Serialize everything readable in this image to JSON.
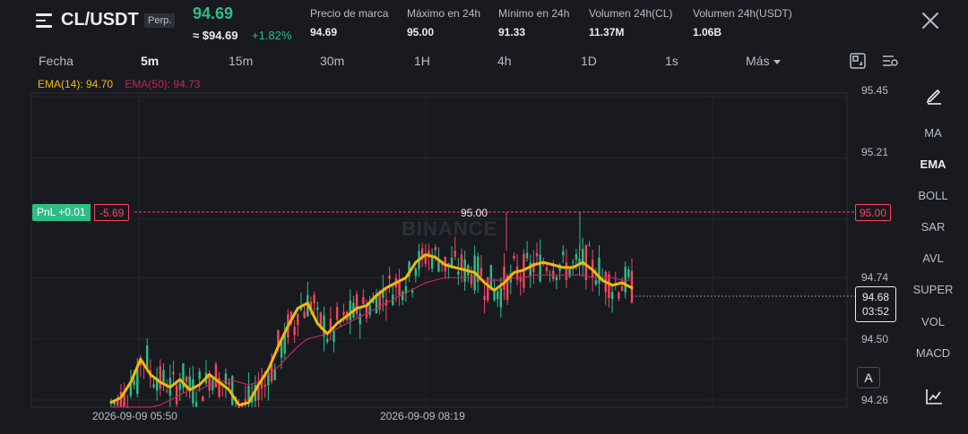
{
  "header": {
    "symbol": "CL/USDT",
    "contract_type": "Perp.",
    "last_price": "94.69",
    "usd_price": "≈ $94.69",
    "change_pct": "+1.82%",
    "stats": [
      {
        "label": "Precio de marca",
        "value": "94.69"
      },
      {
        "label": "Máximo en 24h",
        "value": "95.00"
      },
      {
        "label": "Mínimo en 24h",
        "value": "91.33"
      },
      {
        "label": "Volumen 24h(CL)",
        "value": "11.37M"
      },
      {
        "label": "Volumen 24h(USDT)",
        "value": "1.06B"
      }
    ]
  },
  "timeframes": [
    "Fecha",
    "5m",
    "15m",
    "30m",
    "1H",
    "4h",
    "1D",
    "1s",
    "Más"
  ],
  "active_timeframe": "5m",
  "legend": {
    "ema14": "EMA(14): 94.70",
    "ema50": "EMA(50): 94.73"
  },
  "indicators": [
    "MA",
    "EMA",
    "BOLL",
    "SAR",
    "AVL",
    "SUPER",
    "VOL",
    "MACD"
  ],
  "active_indicator": "EMA",
  "price_axis": [
    "95.45",
    "95.21",
    "94.74",
    "94.50",
    "94.26"
  ],
  "position": {
    "pnl_label": "PnL +0.01",
    "pnl_value": "-5.69",
    "entry_price": "95.00"
  },
  "current": {
    "price": "94.68",
    "countdown": "03:52"
  },
  "high_marker": "95.00",
  "time_axis": [
    "2026-09-09 05:50",
    "2026-09-09 08:19"
  ],
  "watermark": "BINANCE",
  "auto_button": "A",
  "colors": {
    "up": "#2ebd85",
    "down": "#f6465d",
    "ema14": "#f0b90b",
    "ema50": "#c2255c",
    "bg": "#181a20"
  },
  "chart_data": {
    "type": "candlestick",
    "ylim": [
      94.2,
      95.5
    ],
    "series": [
      {
        "name": "EMA(14)",
        "values": [
          94.25,
          94.27,
          94.33,
          94.42,
          94.36,
          94.33,
          94.31,
          94.34,
          94.3,
          94.32,
          94.36,
          94.33,
          94.3,
          94.24,
          94.25,
          94.32,
          94.38,
          94.47,
          94.55,
          94.62,
          94.64,
          94.56,
          94.52,
          94.56,
          94.59,
          94.62,
          94.63,
          94.67,
          94.7,
          94.72,
          94.74,
          94.8,
          94.83,
          94.82,
          94.79,
          94.78,
          94.77,
          94.76,
          94.72,
          94.69,
          94.72,
          94.76,
          94.77,
          94.79,
          94.8,
          94.79,
          94.78,
          94.78,
          94.8,
          94.77,
          94.73,
          94.71,
          94.72,
          94.7
        ]
      },
      {
        "name": "EMA(50)",
        "values": [
          94.1,
          94.12,
          94.15,
          94.2,
          94.22,
          94.24,
          94.26,
          94.28,
          94.3,
          94.3,
          94.32,
          94.33,
          94.34,
          94.33,
          94.32,
          94.33,
          94.36,
          94.39,
          94.43,
          94.47,
          94.5,
          94.51,
          94.52,
          94.54,
          94.56,
          94.58,
          94.6,
          94.62,
          94.64,
          94.66,
          94.68,
          94.7,
          94.72,
          94.73,
          94.74,
          94.74,
          94.74,
          94.74,
          94.73,
          94.73,
          94.73,
          94.74,
          94.74,
          94.75,
          94.75,
          94.75,
          94.75,
          94.75,
          94.75,
          94.74,
          94.74,
          94.74,
          94.73,
          94.73
        ]
      }
    ]
  }
}
